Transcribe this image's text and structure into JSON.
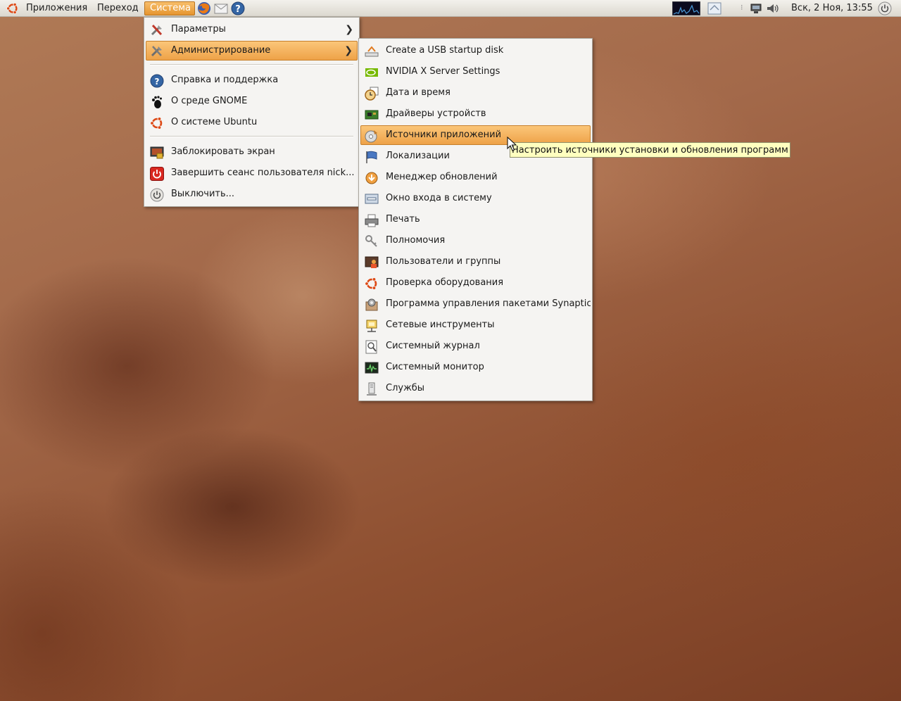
{
  "panel": {
    "menus": [
      "Приложения",
      "Переход",
      "Система"
    ],
    "active_menu": "Система",
    "launchers": [
      "firefox-icon",
      "mail-icon",
      "help-icon"
    ],
    "clock": "Вск,  2 Ноя, 13:55",
    "tray_icons": [
      "system-monitor-applet-icon",
      "workspace-switcher-icon",
      "network-icon",
      "volume-icon",
      "power-icon"
    ]
  },
  "system_menu": {
    "items": [
      {
        "label": "Параметры",
        "icon": "preferences-icon",
        "submenu": true
      },
      {
        "label": "Администрирование",
        "icon": "administration-icon",
        "submenu": true,
        "highlighted": true
      },
      {
        "label": "Справка и поддержка",
        "icon": "help-icon"
      },
      {
        "label": "О среде GNOME",
        "icon": "gnome-foot-icon"
      },
      {
        "label": "О системе Ubuntu",
        "icon": "ubuntu-icon"
      },
      {
        "label": "Заблокировать экран",
        "icon": "lock-screen-icon"
      },
      {
        "label": "Завершить сеанс пользователя nick...",
        "icon": "logout-icon"
      },
      {
        "label": "Выключить...",
        "icon": "shutdown-icon"
      }
    ]
  },
  "admin_menu": {
    "items": [
      {
        "label": "Create a USB startup disk",
        "icon": "usb-disk-icon"
      },
      {
        "label": "NVIDIA X Server Settings",
        "icon": "nvidia-icon"
      },
      {
        "label": "Дата и время",
        "icon": "clock-icon"
      },
      {
        "label": "Драйверы устройств",
        "icon": "driver-card-icon"
      },
      {
        "label": "Источники приложений",
        "icon": "software-sources-icon",
        "highlighted": true
      },
      {
        "label": "Локализации",
        "icon": "language-flag-icon"
      },
      {
        "label": "Менеджер обновлений",
        "icon": "update-manager-icon"
      },
      {
        "label": "Окно входа в систему",
        "icon": "login-window-icon"
      },
      {
        "label": "Печать",
        "icon": "printer-icon"
      },
      {
        "label": "Полномочия",
        "icon": "keys-icon"
      },
      {
        "label": "Пользователи и группы",
        "icon": "users-groups-icon"
      },
      {
        "label": "Проверка оборудования",
        "icon": "hardware-test-icon"
      },
      {
        "label": "Программа управления пакетами Synaptic",
        "icon": "synaptic-icon"
      },
      {
        "label": "Сетевые инструменты",
        "icon": "network-tools-icon"
      },
      {
        "label": "Системный журнал",
        "icon": "system-log-icon"
      },
      {
        "label": "Системный монитор",
        "icon": "system-monitor-icon"
      },
      {
        "label": "Службы",
        "icon": "services-icon"
      }
    ]
  },
  "tooltip": {
    "text": "Настроить источники установки и обновления программ"
  },
  "colors": {
    "highlight": "#eea248",
    "menu_bg": "#f5f4f2",
    "tooltip_bg": "#ffffbf"
  }
}
